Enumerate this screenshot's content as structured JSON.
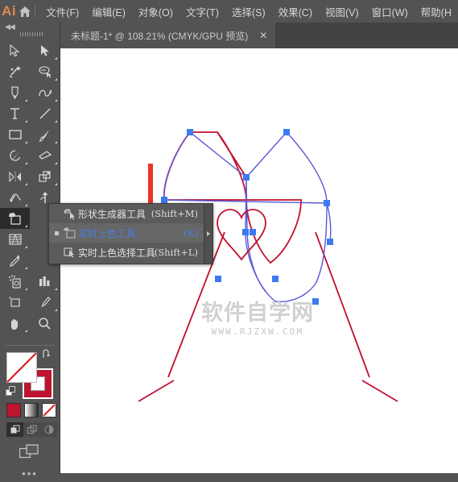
{
  "app": {
    "logo": "Ai",
    "home_icon": "home-icon"
  },
  "menubar": {
    "items": [
      {
        "label": "文件(F)"
      },
      {
        "label": "编辑(E)"
      },
      {
        "label": "对象(O)"
      },
      {
        "label": "文字(T)"
      },
      {
        "label": "选择(S)"
      },
      {
        "label": "效果(C)"
      },
      {
        "label": "视图(V)"
      },
      {
        "label": "窗口(W)"
      },
      {
        "label": "帮助(H"
      }
    ]
  },
  "tabbar": {
    "document_title": "未标题-1* @ 108.21% (CMYK/GPU 预览)",
    "close_label": "✕"
  },
  "toolpanel": {
    "collapse_label": "◀◀",
    "tools": [
      {
        "name": "selection-tool"
      },
      {
        "name": "direct-selection-tool"
      },
      {
        "name": "magic-wand-tool"
      },
      {
        "name": "lasso-tool"
      },
      {
        "name": "pen-tool"
      },
      {
        "name": "curvature-tool"
      },
      {
        "name": "type-tool"
      },
      {
        "name": "line-segment-tool"
      },
      {
        "name": "rectangle-tool"
      },
      {
        "name": "paintbrush-tool"
      },
      {
        "name": "shaper-tool"
      },
      {
        "name": "eraser-tool"
      },
      {
        "name": "rotate-tool"
      },
      {
        "name": "scale-tool"
      },
      {
        "name": "width-tool"
      },
      {
        "name": "free-transform-tool"
      },
      {
        "name": "shape-builder-tool"
      },
      {
        "name": "perspective-grid-tool"
      },
      {
        "name": "mesh-tool"
      },
      {
        "name": "eyedropper-tool"
      },
      {
        "name": "blend-tool"
      },
      {
        "name": "column-graph-tool"
      },
      {
        "name": "artboard-tool"
      },
      {
        "name": "slice-tool"
      },
      {
        "name": "hand-tool"
      },
      {
        "name": "zoom-tool"
      }
    ],
    "active_tool": "shape-builder-tool",
    "fill_stroke": {
      "fill_label": "none",
      "fill_color": "#ffffff",
      "stroke_color": "#bf1430",
      "swap_icon": "swap-fill-stroke-icon",
      "default_icon": "default-fill-stroke-icon"
    },
    "swatches": [
      {
        "name": "color-swatch",
        "color": "#bf1430"
      },
      {
        "name": "gradient-swatch",
        "color": "#808080"
      },
      {
        "name": "none-swatch",
        "color": "#ffffff"
      }
    ],
    "draw_modes": [
      {
        "name": "draw-normal",
        "active": true
      },
      {
        "name": "draw-behind",
        "active": false
      },
      {
        "name": "draw-inside",
        "active": false
      }
    ],
    "screen_mode_icon": "screen-mode-icon",
    "more_tools_label": "•••"
  },
  "flyout": {
    "rows": [
      {
        "label": "形状生成器工具",
        "shortcut": "(Shift+M)",
        "icon": "shape-builder-icon",
        "selected": false,
        "bullet": false
      },
      {
        "label": "实时上色工具",
        "shortcut": "(K)",
        "icon": "live-paint-bucket-icon",
        "selected": true,
        "bullet": true
      },
      {
        "label": "实时上色选择工具",
        "shortcut": "(Shift+L)",
        "icon": "live-paint-selection-icon",
        "selected": false,
        "bullet": false
      }
    ],
    "tear_off_icon": "tear-off-arrow-icon"
  },
  "canvas": {
    "annotation_arrow": {
      "name": "red-down-arrow",
      "color": "#f03125"
    },
    "artwork": {
      "stroke_color": "#c01030",
      "path_color": "#5a58d8",
      "anchor_color": "#3a7bf0",
      "description": "two-wine-glasses-with-heart"
    },
    "watermark": {
      "chinese": "软件自学网",
      "url": "WWW.RJZXW.COM"
    }
  }
}
